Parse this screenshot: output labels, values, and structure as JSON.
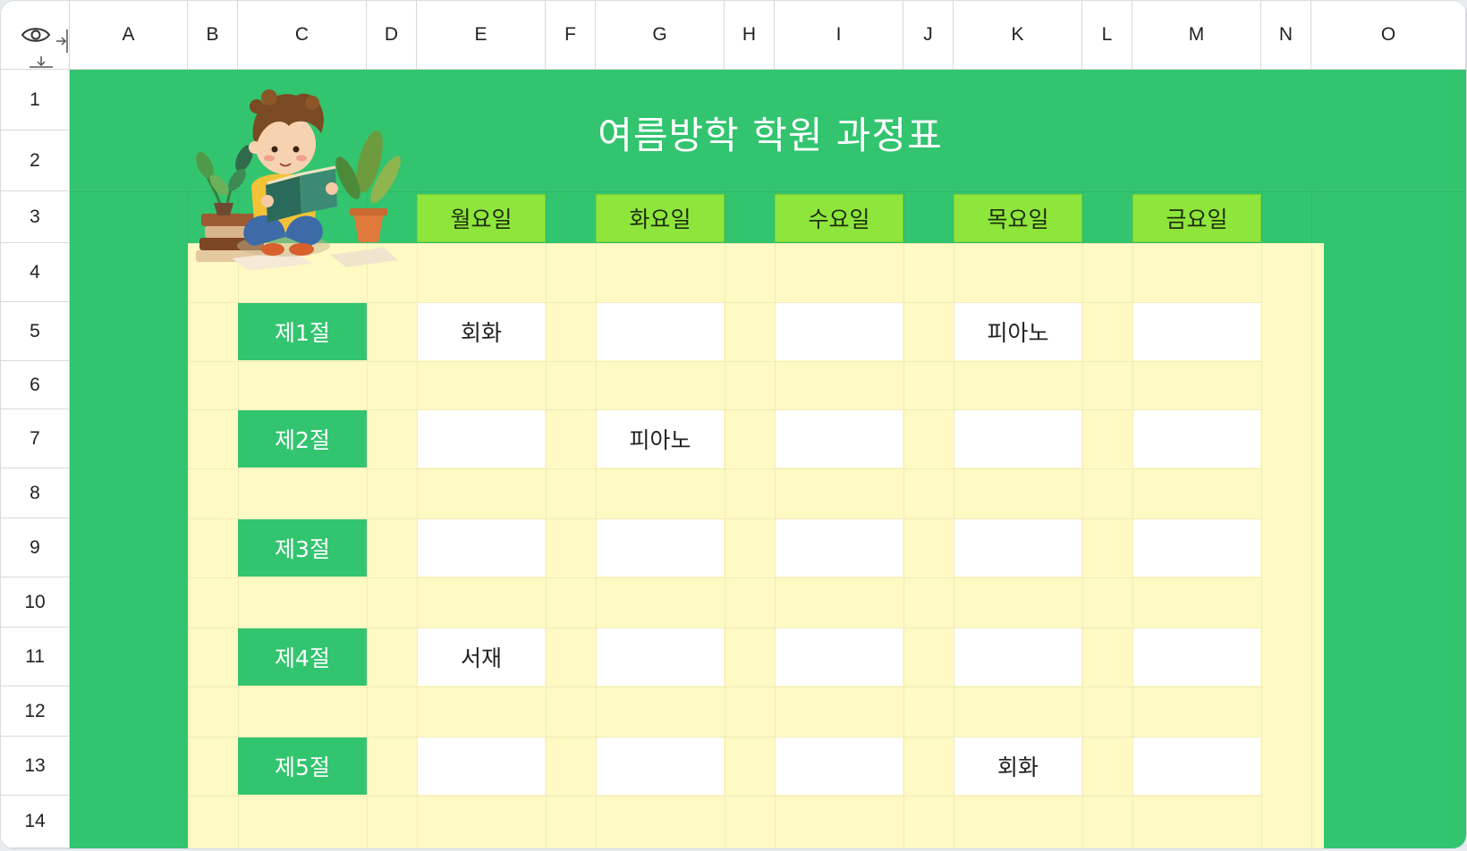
{
  "columns": [
    "A",
    "B",
    "C",
    "D",
    "E",
    "F",
    "G",
    "H",
    "I",
    "J",
    "K",
    "L",
    "M",
    "N",
    "O"
  ],
  "rows": [
    "1",
    "2",
    "3",
    "4",
    "5",
    "6",
    "7",
    "8",
    "9",
    "10",
    "11",
    "12",
    "13",
    "14"
  ],
  "title": "여름방학 학원 과정표",
  "days": [
    "월요일",
    "화요일",
    "수요일",
    "목요일",
    "금요일"
  ],
  "periods": [
    "제1절",
    "제2절",
    "제3절",
    "제4절",
    "제5절"
  ],
  "schedule": [
    [
      "회화",
      "",
      "",
      "피아노",
      ""
    ],
    [
      "",
      "피아노",
      "",
      "",
      ""
    ],
    [
      "",
      "",
      "",
      "",
      ""
    ],
    [
      "서재",
      "",
      "",
      "",
      ""
    ],
    [
      "",
      "",
      "",
      "회화",
      ""
    ]
  ],
  "colors": {
    "header_green": "#33c46f",
    "day_header": "#8ee63c",
    "table_yellow": "#fff9c4",
    "slot": "#ffffff"
  },
  "icons": {
    "visibility": "eye-icon",
    "collapse_columns": "collapse-columns-icon",
    "collapse_rows": "collapse-rows-icon",
    "illustration": "child-reading-book-illustration"
  }
}
